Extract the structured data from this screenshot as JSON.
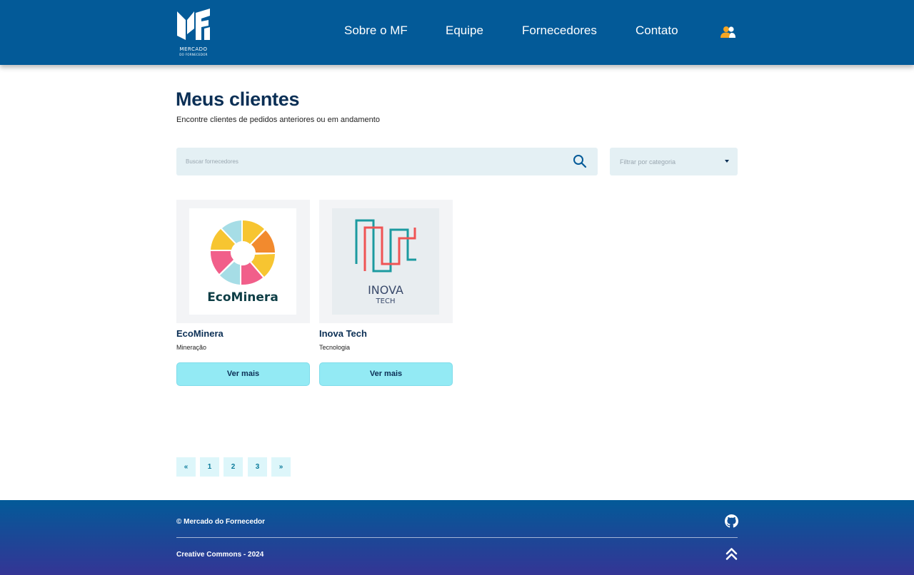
{
  "brand": {
    "name": "MERCADO",
    "sub": "DO FORNECEDOR",
    "logo_icon": "mf-logo-icon"
  },
  "nav": {
    "items": [
      {
        "label": "Sobre o MF"
      },
      {
        "label": "Equipe"
      },
      {
        "label": "Fornecedores"
      },
      {
        "label": "Contato"
      }
    ],
    "user_icon": "users-icon"
  },
  "page": {
    "title": "Meus clientes",
    "subtitle": "Encontre clientes de pedidos anteriores ou em andamento"
  },
  "search": {
    "placeholder": "Buscar fornecedores",
    "icon": "search-icon"
  },
  "filter": {
    "label": "Filtrar por categoria",
    "icon": "caret-down-icon"
  },
  "clients": [
    {
      "name": "EcoMinera",
      "category": "Mineração",
      "logo_text": "EcoMinera",
      "button": "Ver mais"
    },
    {
      "name": "Inova Tech",
      "category": "Tecnologia",
      "logo_text_1": "INOVA",
      "logo_text_2": "TECH",
      "button": "Ver mais"
    }
  ],
  "pagination": {
    "first": "«",
    "pages": [
      "1",
      "2",
      "3"
    ],
    "last": "»"
  },
  "footer": {
    "copyright": "© Mercado do Fornecedor",
    "license": "Creative Commons - 2024",
    "github_icon": "github-icon",
    "top_icon": "double-chevron-up-icon"
  },
  "colors": {
    "header": "#035a98",
    "footer_top": "#035a98",
    "footer_bottom": "#343595",
    "button": "#93eaf4",
    "title": "#0b2f55",
    "input_bg": "#e4f0f4"
  }
}
